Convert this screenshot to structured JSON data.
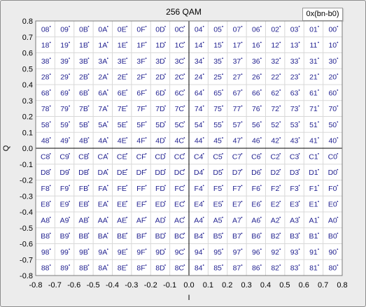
{
  "chart_data": {
    "type": "scatter",
    "title": "256 QAM",
    "legend": "0x(bn-b0)",
    "xlabel": "I",
    "ylabel": "Q",
    "xlim": [
      -0.8,
      0.8
    ],
    "ylim": [
      -0.8,
      0.8
    ],
    "grid": true,
    "x_ticks": [
      "-0.8",
      "-0.7",
      "-0.6",
      "-0.5",
      "-0.4",
      "-0.3",
      "-0.2",
      "-0.1",
      "0.0",
      "0.1",
      "0.2",
      "0.3",
      "0.4",
      "0.5",
      "0.6",
      "0.7",
      "0.8"
    ],
    "y_ticks": [
      "0.8",
      "0.7",
      "0.6",
      "0.5",
      "0.4",
      "0.3",
      "0.2",
      "0.1",
      "0.0",
      "-0.1",
      "-0.2",
      "-0.3",
      "-0.4",
      "-0.5",
      "-0.6",
      "-0.7",
      "-0.8"
    ],
    "x_levels": [
      -0.75,
      -0.65,
      -0.55,
      -0.45,
      -0.35,
      -0.25,
      -0.15,
      -0.05,
      0.05,
      0.15,
      0.25,
      0.35,
      0.45,
      0.55,
      0.65,
      0.75
    ],
    "y_levels": [
      0.75,
      0.65,
      0.55,
      0.45,
      0.35,
      0.25,
      0.15,
      0.05,
      -0.05,
      -0.15,
      -0.25,
      -0.35,
      -0.45,
      -0.55,
      -0.65,
      -0.75
    ],
    "labels": [
      [
        "08",
        "09",
        "0B",
        "0A",
        "0E",
        "0F",
        "0D",
        "0C",
        "04",
        "05",
        "07",
        "06",
        "02",
        "03",
        "01",
        "00"
      ],
      [
        "18",
        "19",
        "1B",
        "1A",
        "1E",
        "1F",
        "1D",
        "1C",
        "14",
        "15",
        "17",
        "16",
        "12",
        "13",
        "11",
        "10"
      ],
      [
        "38",
        "39",
        "3B",
        "3A",
        "3E",
        "3F",
        "3D",
        "3C",
        "34",
        "35",
        "37",
        "36",
        "32",
        "33",
        "31",
        "30"
      ],
      [
        "28",
        "29",
        "2B",
        "2A",
        "2E",
        "2F",
        "2D",
        "2C",
        "24",
        "25",
        "27",
        "26",
        "22",
        "23",
        "21",
        "20"
      ],
      [
        "68",
        "69",
        "6B",
        "6A",
        "6E",
        "6F",
        "6D",
        "6C",
        "64",
        "65",
        "67",
        "66",
        "62",
        "63",
        "61",
        "60"
      ],
      [
        "78",
        "79",
        "7B",
        "7A",
        "7E",
        "7F",
        "7D",
        "7C",
        "74",
        "75",
        "77",
        "76",
        "72",
        "73",
        "71",
        "70"
      ],
      [
        "58",
        "59",
        "5B",
        "5A",
        "5E",
        "5F",
        "5D",
        "5C",
        "54",
        "55",
        "57",
        "56",
        "52",
        "53",
        "51",
        "50"
      ],
      [
        "48",
        "49",
        "4B",
        "4A",
        "4E",
        "4F",
        "4D",
        "4C",
        "44",
        "45",
        "47",
        "46",
        "42",
        "43",
        "41",
        "40"
      ],
      [
        "C8",
        "C9",
        "CB",
        "CA",
        "CE",
        "CF",
        "CD",
        "CC",
        "C4",
        "C5",
        "C7",
        "C6",
        "C2",
        "C3",
        "C1",
        "C0"
      ],
      [
        "D8",
        "D9",
        "DB",
        "DA",
        "DE",
        "DF",
        "DD",
        "DC",
        "D4",
        "D5",
        "D7",
        "D6",
        "D2",
        "D3",
        "D1",
        "D0"
      ],
      [
        "F8",
        "F9",
        "FB",
        "FA",
        "FE",
        "FF",
        "FD",
        "FC",
        "F4",
        "F5",
        "F7",
        "F6",
        "F2",
        "F3",
        "F1",
        "F0"
      ],
      [
        "E8",
        "E9",
        "EB",
        "EA",
        "EE",
        "EF",
        "ED",
        "EC",
        "E4",
        "E5",
        "E7",
        "E6",
        "E2",
        "E3",
        "E1",
        "E0"
      ],
      [
        "A8",
        "A9",
        "AB",
        "AA",
        "AE",
        "AF",
        "AD",
        "AC",
        "A4",
        "A5",
        "A7",
        "A6",
        "A2",
        "A3",
        "A1",
        "A0"
      ],
      [
        "B8",
        "B9",
        "BB",
        "BA",
        "BE",
        "BF",
        "BD",
        "BC",
        "B4",
        "B5",
        "B7",
        "B6",
        "B2",
        "B3",
        "B1",
        "B0"
      ],
      [
        "98",
        "99",
        "9B",
        "9A",
        "9E",
        "9F",
        "9D",
        "9C",
        "94",
        "95",
        "97",
        "96",
        "92",
        "93",
        "91",
        "90"
      ],
      [
        "88",
        "89",
        "8B",
        "8A",
        "8E",
        "8F",
        "8D",
        "8C",
        "84",
        "85",
        "87",
        "86",
        "82",
        "83",
        "81",
        "80"
      ]
    ],
    "colors": {
      "plot_bg": "#ffffff",
      "grid": "#d8d8d8",
      "axis": "#000000",
      "points": "#1f1f8f"
    }
  }
}
